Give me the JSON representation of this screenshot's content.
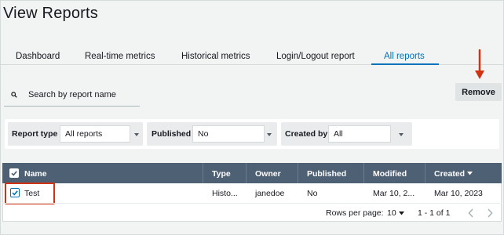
{
  "page": {
    "title": "View Reports"
  },
  "tabs": [
    {
      "label": "Dashboard",
      "active": false
    },
    {
      "label": "Real-time metrics",
      "active": false
    },
    {
      "label": "Historical metrics",
      "active": false
    },
    {
      "label": "Login/Logout report",
      "active": false
    },
    {
      "label": "All reports",
      "active": true
    }
  ],
  "search": {
    "placeholder": "Search by report name",
    "value": "",
    "icon": "search-icon"
  },
  "actions": {
    "remove_label": "Remove"
  },
  "filters": [
    {
      "label": "Report type",
      "value": "All reports"
    },
    {
      "label": "Published",
      "value": "No"
    },
    {
      "label": "Created by",
      "value": "All"
    }
  ],
  "table": {
    "columns": [
      "Name",
      "Type",
      "Owner",
      "Published",
      "Modified",
      "Created"
    ],
    "sort": {
      "column": "Created",
      "direction": "desc"
    },
    "rows": [
      {
        "selected": true,
        "name": "Test",
        "type": "Histo...",
        "owner": "janedoe",
        "published": "No",
        "modified": "Mar 10, 2...",
        "created": "Mar 10, 2023"
      }
    ]
  },
  "pagination": {
    "rows_per_page_label": "Rows per page:",
    "rows_per_page": "10",
    "range": "1 - 1 of 1"
  },
  "colors": {
    "accent": "#0073bb",
    "header_bg": "#4d6074",
    "highlight": "#d13212"
  }
}
